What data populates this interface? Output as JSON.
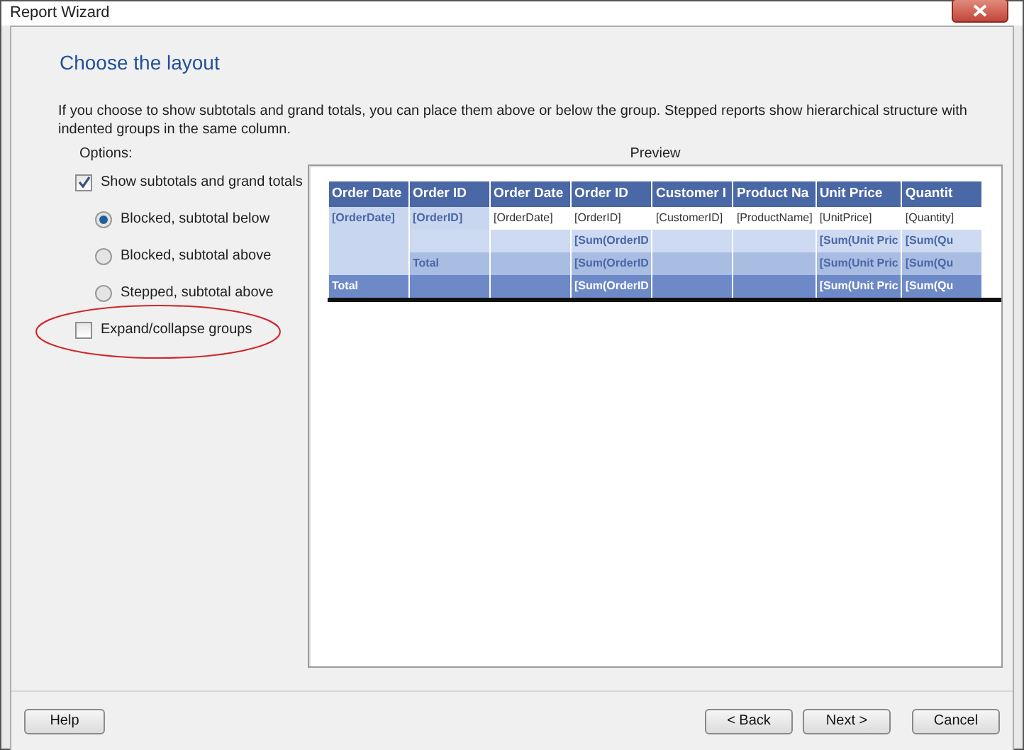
{
  "window": {
    "title": "Report Wizard"
  },
  "heading": "Choose the layout",
  "description": "If you choose to show subtotals and grand totals, you can place them above or below the group. Stepped reports show hierarchical structure with indented groups in the same column.",
  "options": {
    "label": "Options:",
    "items": [
      {
        "kind": "checkbox",
        "label": "Show subtotals and grand totals",
        "checked": true,
        "circled": false
      },
      {
        "kind": "radio",
        "label": "Blocked, subtotal below",
        "selected": true
      },
      {
        "kind": "radio",
        "label": "Blocked, subtotal above",
        "selected": false
      },
      {
        "kind": "radio",
        "label": "Stepped, subtotal above",
        "selected": false
      },
      {
        "kind": "checkbox",
        "label": "Expand/collapse groups",
        "checked": false,
        "circled": true
      }
    ]
  },
  "preview": {
    "label": "Preview",
    "columns": [
      "Order Date",
      "Order ID",
      "Order Date",
      "Order ID",
      "Customer I",
      "Product Na",
      "Unit Price",
      "Quantit"
    ],
    "rows": [
      {
        "kind": "detail",
        "cells": [
          "[OrderDate]",
          "[OrderID]",
          "[OrderDate]",
          "[OrderID]",
          "[CustomerID]",
          "[ProductName]",
          "[UnitPrice]",
          "[Quantity]"
        ]
      },
      {
        "kind": "subtotal",
        "cells": [
          null,
          null,
          null,
          "[Sum(OrderID",
          null,
          null,
          "[Sum(Unit Pric",
          "[Sum(Qu"
        ]
      },
      {
        "kind": "group_total",
        "cells": [
          null,
          "Total",
          null,
          "[Sum(OrderID",
          null,
          null,
          "[Sum(Unit Pric",
          "[Sum(Qu"
        ]
      },
      {
        "kind": "grand_total",
        "cells": [
          "Total",
          null,
          null,
          "[Sum(OrderID",
          null,
          null,
          "[Sum(Unit Pric",
          "[Sum(Qu"
        ]
      }
    ]
  },
  "buttons": [
    "Help",
    "< Back",
    "Next >",
    "Cancel"
  ]
}
